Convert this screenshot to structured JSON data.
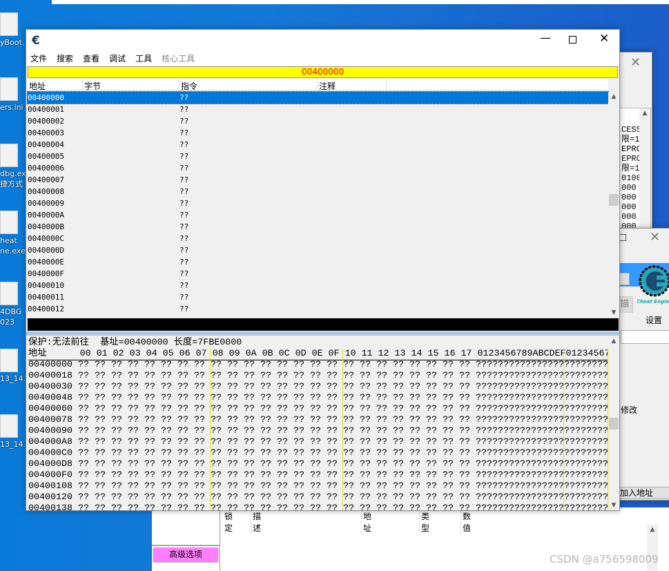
{
  "desktop": {
    "icons": [
      "yBoot...",
      "ers.ini",
      "dbg.exe\n捷方式",
      "heat\nne.exe",
      "4DBG\n023",
      "13_14...",
      "13_14..."
    ]
  },
  "window": {
    "title_icon": "cheat-engine-logo",
    "menu": [
      "文件",
      "搜索",
      "查看",
      "调试",
      "工具",
      "核心工具"
    ],
    "address_bar": "00400000",
    "disasm_headers": [
      "地址",
      "字节",
      "指令",
      "注释"
    ],
    "disasm_rows": [
      "00400000",
      "00400001",
      "00400002",
      "00400003",
      "00400004",
      "00400005",
      "00400006",
      "00400007",
      "00400008",
      "00400009",
      "0040000A",
      "0040000B",
      "0040000C",
      "0040000D",
      "0040000E",
      "0040000F",
      "00400010",
      "00400011",
      "00400012"
    ],
    "disasm_instruction": "??",
    "hex_info": "保护:无法前往  基址=00400000 长度=7FBE0000",
    "hex_header_label": "地址",
    "hex_columns": "00 01 02 03 04 05 06 07 08 09 0A 0B 0C 0D 0E 0F 10 11 12 13 14 15 16 17 0123456789ABCDEF01234567",
    "hex_rows": [
      "00400000",
      "00400018",
      "00400030",
      "00400048",
      "00400060",
      "00400078",
      "00400090",
      "004000A8",
      "004000C0",
      "004000D8",
      "004000F0",
      "00400108",
      "00400120",
      "00400138"
    ],
    "hex_byte": "??"
  },
  "bg_window1": {
    "lines": [
      "CESS",
      "限=1",
      "EPRC",
      "EPRC",
      "限=1",
      "0100",
      "000",
      "000",
      "000",
      "000",
      "000"
    ]
  },
  "bg_window2": {
    "settings_label": "设置",
    "scan_fragment": "描",
    "modify_fragment": "修改",
    "add_address": "加入地址",
    "logo_text": "Cheat Engine"
  },
  "main_ce": {
    "advanced_options": "高级选项",
    "columns": [
      "锁定",
      "描述",
      "地址",
      "类型",
      "数值"
    ],
    "advanced_color": "#ff80ff"
  },
  "watermark": "CSDN @a756598009",
  "colors": {
    "highlight": "#0078d7",
    "address_bar_bg": "#ffff00",
    "address_bar_text": "#ff0000"
  }
}
